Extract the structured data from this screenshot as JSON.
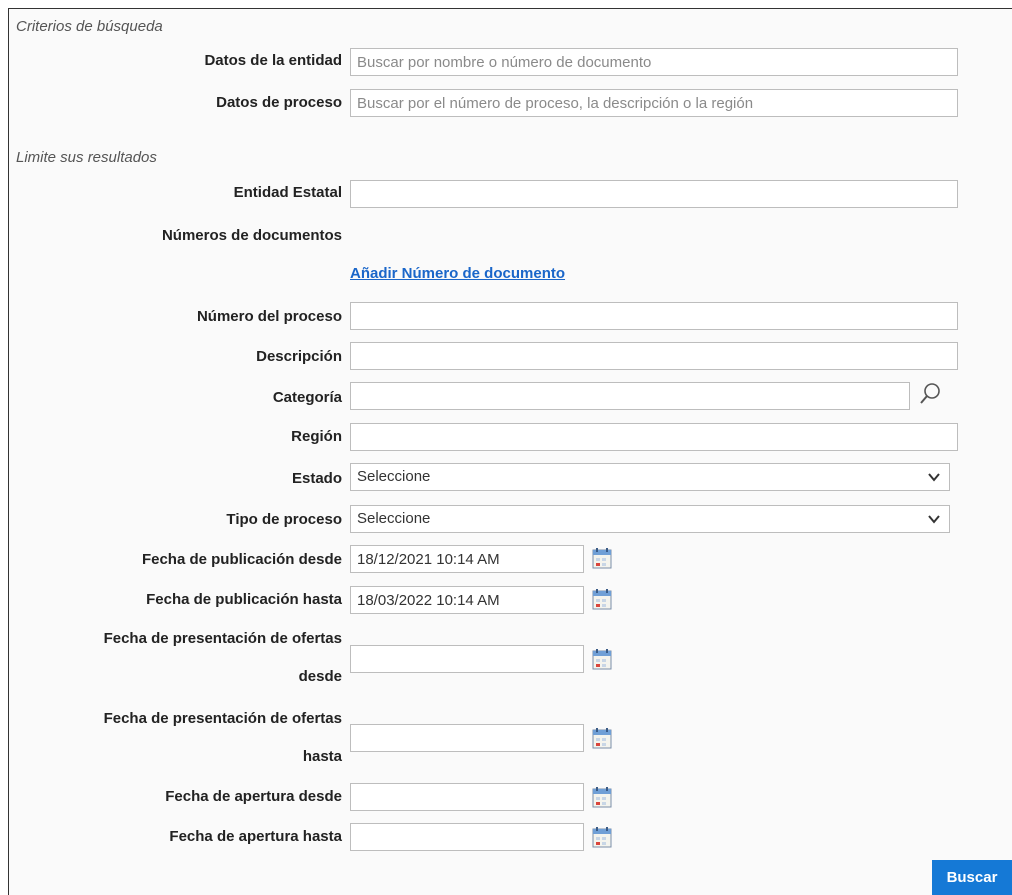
{
  "criteria": {
    "title": "Criterios de búsqueda",
    "entity_label": "Datos de la entidad",
    "entity_placeholder": "Buscar por nombre o número de documento",
    "process_label": "Datos de proceso",
    "process_placeholder": "Buscar por el número de proceso, la descripción o la región"
  },
  "limit": {
    "title": "Limite sus resultados",
    "entidad_label": "Entidad Estatal",
    "docs_label": "Números de documentos",
    "add_doc_link": "Añadir Número de documento",
    "proceso_num_label": "Número del proceso",
    "descripcion_label": "Descripción",
    "categoria_label": "Categoría",
    "region_label": "Región",
    "estado_label": "Estado",
    "estado_value": "Seleccione",
    "tipo_label": "Tipo de proceso",
    "tipo_value": "Seleccione",
    "pub_desde_label": "Fecha de publicación desde",
    "pub_desde_value": "18/12/2021 10:14 AM",
    "pub_hasta_label": "Fecha de publicación hasta",
    "pub_hasta_value": "18/03/2022 10:14 AM",
    "pres_desde_label_1": "Fecha de presentación de ofertas",
    "pres_desde_label_2": "desde",
    "pres_hasta_label_1": "Fecha de presentación de ofertas",
    "pres_hasta_label_2": "hasta",
    "apertura_desde_label": "Fecha de apertura desde",
    "apertura_hasta_label": "Fecha de apertura hasta"
  },
  "actions": {
    "search": "Buscar"
  },
  "icons": {
    "category_search": "magnifier-icon",
    "date_picker": "calendar-icon",
    "select_arrow": "chevron-down-icon"
  },
  "colors": {
    "link": "#1a66c9",
    "button": "#1579d6"
  }
}
